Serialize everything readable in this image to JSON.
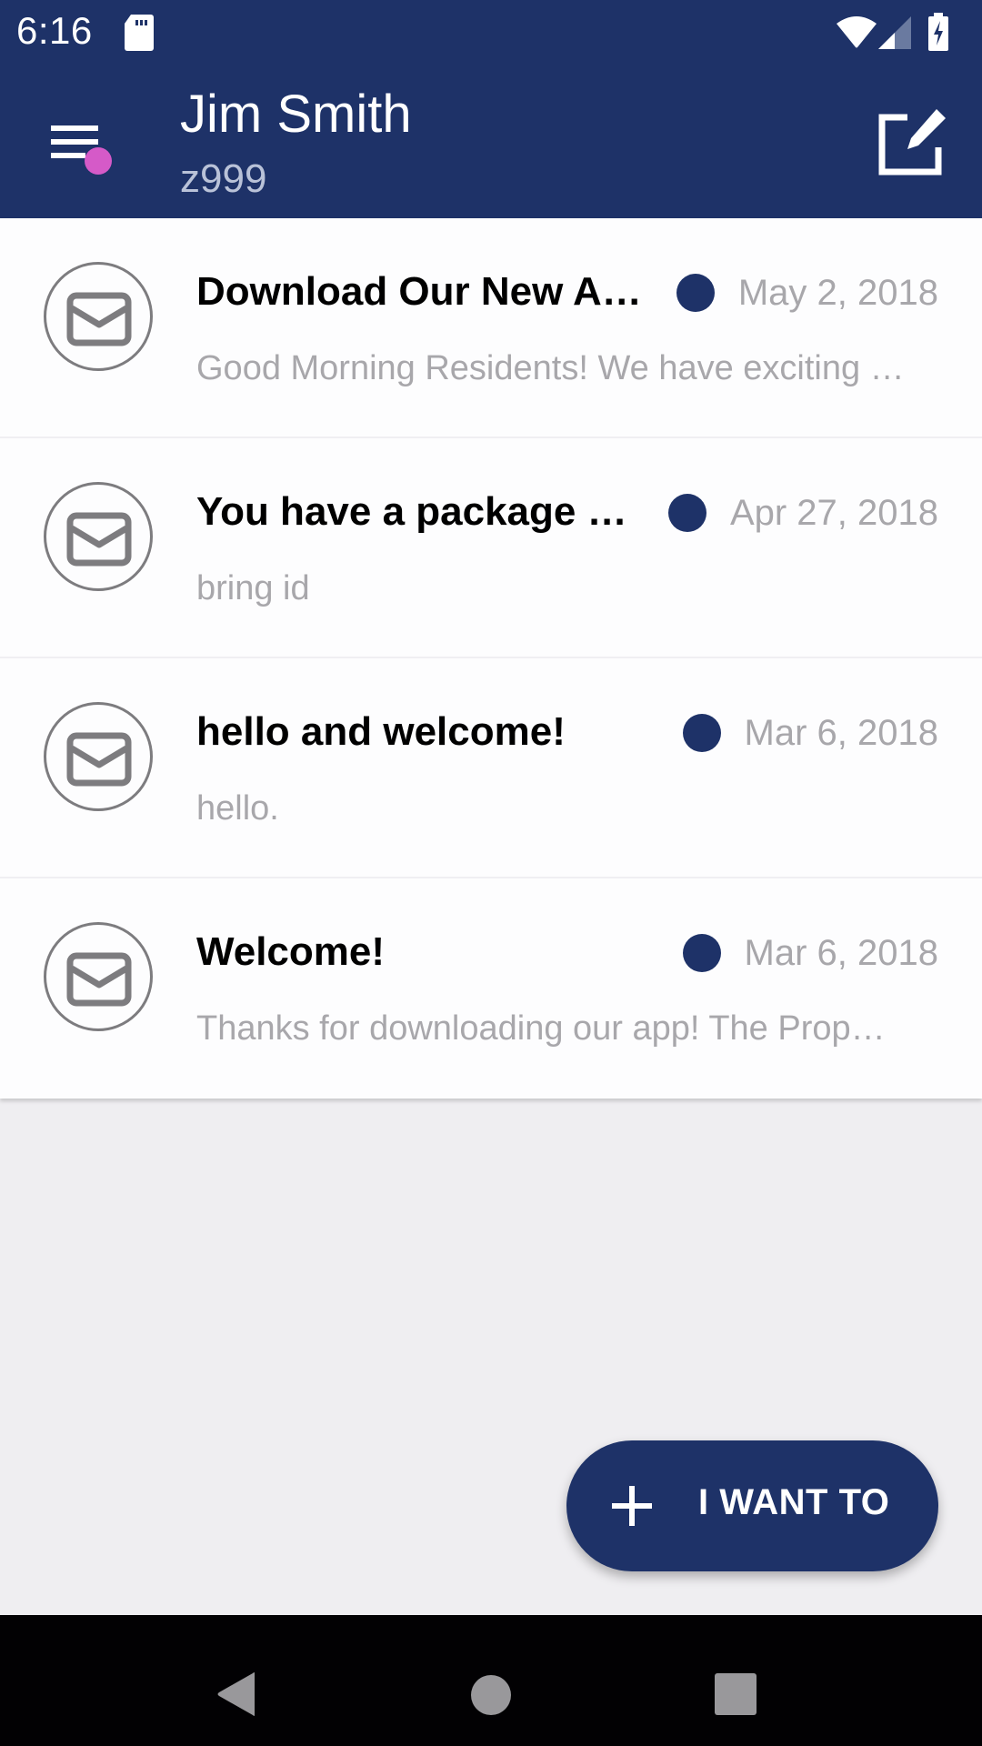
{
  "status_bar": {
    "time": "6:16",
    "icons": [
      "sd-card-icon",
      "wifi-icon",
      "cell-signal-icon",
      "battery-charging-icon"
    ]
  },
  "header": {
    "title": "Jim Smith",
    "subtitle": "z999",
    "menu_icon": "menu-icon",
    "menu_badge": "notification-dot",
    "compose_icon": "compose-icon"
  },
  "colors": {
    "primary": "#1e3268",
    "badge": "#d55ac8",
    "secondary_text": "#a8a7ab",
    "background": "#efeef1"
  },
  "messages": [
    {
      "title": "Download Our New A…",
      "date": "May 2, 2018",
      "preview": "Good Morning Residents! We have exciting …",
      "unread": true
    },
    {
      "title": "You have a package …",
      "date": "Apr 27, 2018",
      "preview": "bring id",
      "unread": true
    },
    {
      "title": "hello and welcome!",
      "date": "Mar 6, 2018",
      "preview": "hello.",
      "unread": true
    },
    {
      "title": "Welcome!",
      "date": "Mar 6, 2018",
      "preview": "Thanks for downloading our app! The Prop…",
      "unread": true
    }
  ],
  "fab": {
    "icon": "plus-icon",
    "label": "I WANT TO"
  },
  "nav_bar": {
    "buttons": [
      "back",
      "home",
      "recents"
    ]
  }
}
